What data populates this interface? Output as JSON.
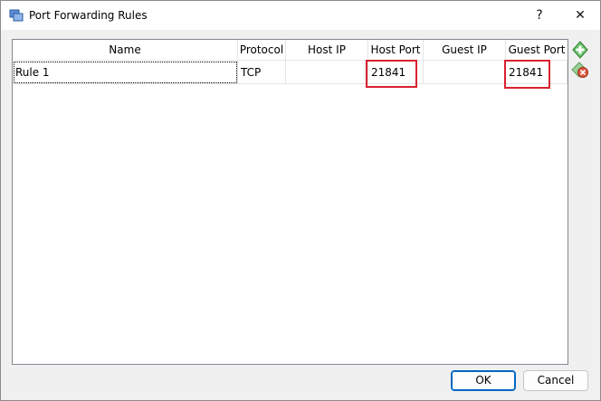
{
  "window": {
    "title": "Port Forwarding Rules",
    "help_glyph": "?",
    "close_glyph": "✕"
  },
  "table": {
    "columns": [
      "Name",
      "Protocol",
      "Host IP",
      "Host Port",
      "Guest IP",
      "Guest Port"
    ],
    "rows": [
      {
        "name": "Rule 1",
        "protocol": "TCP",
        "host_ip": "",
        "host_port": "21841",
        "guest_ip": "",
        "guest_port": "21841"
      }
    ]
  },
  "side_buttons": {
    "add_icon": "add-rule-icon",
    "remove_icon": "remove-rule-icon"
  },
  "buttons": {
    "ok": "OK",
    "cancel": "Cancel"
  },
  "colors": {
    "highlight": "#d9202f",
    "add_green": "#3aa63a",
    "remove_red": "#d64a3a"
  }
}
